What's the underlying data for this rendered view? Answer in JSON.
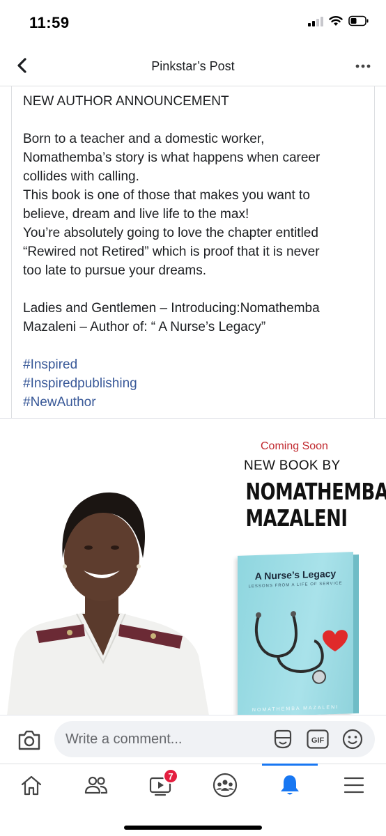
{
  "status_bar": {
    "time": "11:59"
  },
  "header": {
    "title": "Pinkstar’s Post"
  },
  "post": {
    "heading": "NEW AUTHOR ANNOUNCEMENT",
    "lines": [
      "Born to a teacher and a domestic worker,",
      "Nomathemba’s story is what happens when career",
      "collides with calling.",
      "This book is one of those that makes you want to",
      "believe, dream and live life to the max!",
      "You’re absolutely going to love the chapter entitled",
      "“Rewired not Retired” which is proof that it is never",
      "too late to pursue your dreams."
    ],
    "intro_lines": [
      "Ladies and Gentlemen – Introducing:Nomathemba",
      "Mazaleni – Author of: “ A Nurse’s Legacy”"
    ],
    "hashtags": [
      "#Inspired",
      "#Inspiredpublishing",
      "#NewAuthor"
    ]
  },
  "image": {
    "coming_soon": "Coming Soon",
    "new_book_by": "NEW BOOK BY",
    "author_line1": "NOMATHEMBA",
    "author_line2": "MAZALENI",
    "book_title": "A Nurse’s Legacy",
    "book_subtitle": "LESSONS FROM A LIFE OF SERVICE",
    "book_author": "NOMATHEMBA MAZALENI"
  },
  "comment_bar": {
    "placeholder": "Write a comment...",
    "gif_label": "GIF"
  },
  "tab_bar": {
    "tabs": [
      {
        "name": "home",
        "icon": "home-icon"
      },
      {
        "name": "friends",
        "icon": "friends-icon"
      },
      {
        "name": "watch",
        "icon": "video-icon",
        "badge": "7"
      },
      {
        "name": "groups",
        "icon": "groups-icon"
      },
      {
        "name": "notifications",
        "icon": "bell-icon",
        "active": true
      },
      {
        "name": "menu",
        "icon": "menu-icon"
      }
    ]
  },
  "colors": {
    "accent": "#1877f2",
    "hashtag": "#385898",
    "coming_soon": "#c0272d",
    "badge": "#e41e3f"
  }
}
